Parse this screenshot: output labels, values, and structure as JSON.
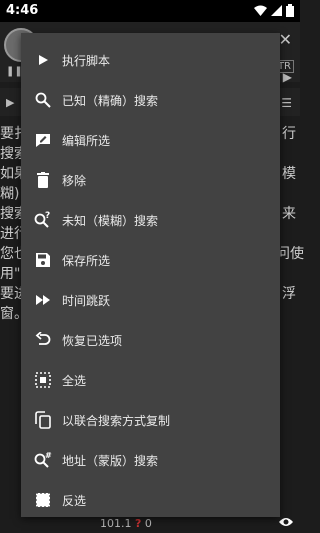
{
  "status_bar": {
    "time": "4:46"
  },
  "background": {
    "left_text": "要扌\n搜索\n如果\n糊)\n搜索\n进行\n您也\n用\"\n要进\n窗。",
    "right_text": "行\n\n模\n\n来\n\n问使\n\n浮\n",
    "tag": "TR",
    "bottom_value": "101.1",
    "bottom_count": "0"
  },
  "menu": {
    "items": [
      {
        "label": "执行脚本",
        "icon": "play-icon"
      },
      {
        "label": "已知（精确）搜索",
        "icon": "search-icon"
      },
      {
        "label": "编辑所选",
        "icon": "edit-icon"
      },
      {
        "label": "移除",
        "icon": "trash-icon"
      },
      {
        "label": "未知（模糊）搜索",
        "icon": "search-unknown-icon"
      },
      {
        "label": "保存所选",
        "icon": "save-icon"
      },
      {
        "label": "时间跳跃",
        "icon": "fast-forward-icon"
      },
      {
        "label": "恢复已选项",
        "icon": "undo-icon"
      },
      {
        "label": "全选",
        "icon": "select-all-icon"
      },
      {
        "label": "以联合搜索方式复制",
        "icon": "copy-icon"
      },
      {
        "label": "地址（蒙版）搜索",
        "icon": "search-address-icon"
      },
      {
        "label": "反选",
        "icon": "invert-selection-icon"
      }
    ]
  }
}
